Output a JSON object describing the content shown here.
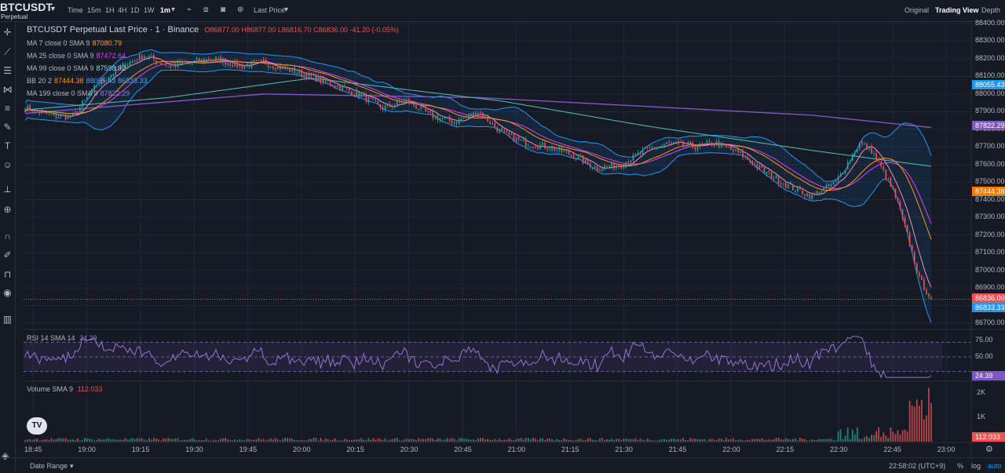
{
  "header": {
    "symbol": "BTCUSDT",
    "symbol_sub": "Perpetual",
    "timeframes": [
      "Time",
      "15m",
      "1H",
      "4H",
      "1D",
      "1W",
      "1m"
    ],
    "active_timeframe": "1m",
    "price_type": "Last Price",
    "right_tabs": [
      "Original",
      "Trading View",
      "Depth"
    ],
    "active_right_tab": "Trading View"
  },
  "legend": {
    "title": "BTCUSDT Perpetual Last Price · 1 · Binance",
    "ohlc": "O86877.00  H86877.00  L86816.70  C86836.00  -41.20 (-0.05%)",
    "ma7": {
      "label": "MA 7 close 0 SMA 9",
      "value": "87080.79",
      "color": "#f7a600"
    },
    "ma25": {
      "label": "MA 25 close 0 SMA 9",
      "value": "87472.64",
      "color": "#e040fb"
    },
    "ma99": {
      "label": "MA 99 close 0 SMA 9",
      "value": "87598.92",
      "color": "#4dd0e1"
    },
    "bb": {
      "label": "BB 20 2",
      "v1": "87444.38",
      "v2": "88055.43",
      "v3": "86833.33"
    },
    "ma199": {
      "label": "MA 199 close 0 SMA 9",
      "value": "87822.29",
      "color": "#7e57c2"
    }
  },
  "rsi": {
    "label": "RSI 14 SMA 14",
    "value": "24.39",
    "badge": "24.39"
  },
  "volume": {
    "label": "Volume SMA 9",
    "value": "112.033",
    "badge": "112.033"
  },
  "badges": {
    "bb_upper": "88055.43",
    "ma199": "87822.29",
    "bb_mid": "87444.38",
    "last": "86836.00",
    "bb_lower": "86833.33"
  },
  "footer": {
    "date_range": "Date Range",
    "clock": "22:58:02 (UTC+9)",
    "percent": "%",
    "log": "log",
    "auto": "auto"
  },
  "colors": {
    "up": "#26a69a",
    "down": "#ef5350",
    "bb": "#2196f3",
    "rsi": "#7e57c2",
    "bg": "#161a25"
  },
  "chart_data": {
    "type": "candlestick",
    "price_axis": {
      "min": 86700,
      "max": 88400,
      "ticks": [
        88400,
        88300,
        88200,
        88100,
        88000,
        87900,
        87800,
        87700,
        87600,
        87500,
        87400,
        87300,
        87200,
        87100,
        87000,
        86900,
        86800,
        86700
      ]
    },
    "rsi_axis": {
      "ticks": [
        "75.00",
        "50.00"
      ]
    },
    "volume_axis": {
      "ticks": [
        "2K",
        "1K"
      ]
    },
    "time_ticks": [
      "18:45",
      "19:00",
      "19:15",
      "19:30",
      "19:45",
      "20:00",
      "20:15",
      "20:30",
      "20:45",
      "21:00",
      "21:15",
      "21:30",
      "21:45",
      "22:00",
      "22:15",
      "22:30",
      "22:45",
      "23:00"
    ],
    "close_anchors": [
      [
        0,
        87920
      ],
      [
        10,
        87880
      ],
      [
        20,
        87870
      ],
      [
        30,
        88050
      ],
      [
        40,
        88150
      ],
      [
        50,
        88220
      ],
      [
        60,
        88160
      ],
      [
        70,
        88180
      ],
      [
        80,
        88200
      ],
      [
        90,
        88160
      ],
      [
        100,
        88180
      ],
      [
        110,
        88140
      ],
      [
        120,
        88100
      ],
      [
        130,
        88050
      ],
      [
        140,
        88000
      ],
      [
        150,
        87920
      ],
      [
        160,
        87960
      ],
      [
        170,
        87880
      ],
      [
        180,
        87840
      ],
      [
        190,
        87900
      ],
      [
        200,
        87780
      ],
      [
        210,
        87720
      ],
      [
        220,
        87700
      ],
      [
        230,
        87650
      ],
      [
        240,
        87580
      ],
      [
        250,
        87600
      ],
      [
        260,
        87680
      ],
      [
        270,
        87720
      ],
      [
        280,
        87700
      ],
      [
        290,
        87720
      ],
      [
        300,
        87660
      ],
      [
        310,
        87560
      ],
      [
        320,
        87480
      ],
      [
        330,
        87420
      ],
      [
        340,
        87500
      ],
      [
        350,
        87720
      ],
      [
        355,
        87680
      ],
      [
        360,
        87560
      ],
      [
        365,
        87420
      ],
      [
        370,
        87200
      ],
      [
        375,
        86950
      ],
      [
        380,
        86836
      ]
    ],
    "ma199_anchors": [
      [
        0,
        87890
      ],
      [
        100,
        88000
      ],
      [
        190,
        87980
      ],
      [
        260,
        87930
      ],
      [
        330,
        87880
      ],
      [
        380,
        87810
      ]
    ],
    "ma99_anchors": [
      [
        0,
        87910
      ],
      [
        60,
        87980
      ],
      [
        120,
        88090
      ],
      [
        200,
        87960
      ],
      [
        260,
        87820
      ],
      [
        330,
        87680
      ],
      [
        380,
        87590
      ]
    ],
    "rsi_range": [
      20,
      80
    ],
    "rsi_last": 24.39,
    "volume_max": 2400
  }
}
